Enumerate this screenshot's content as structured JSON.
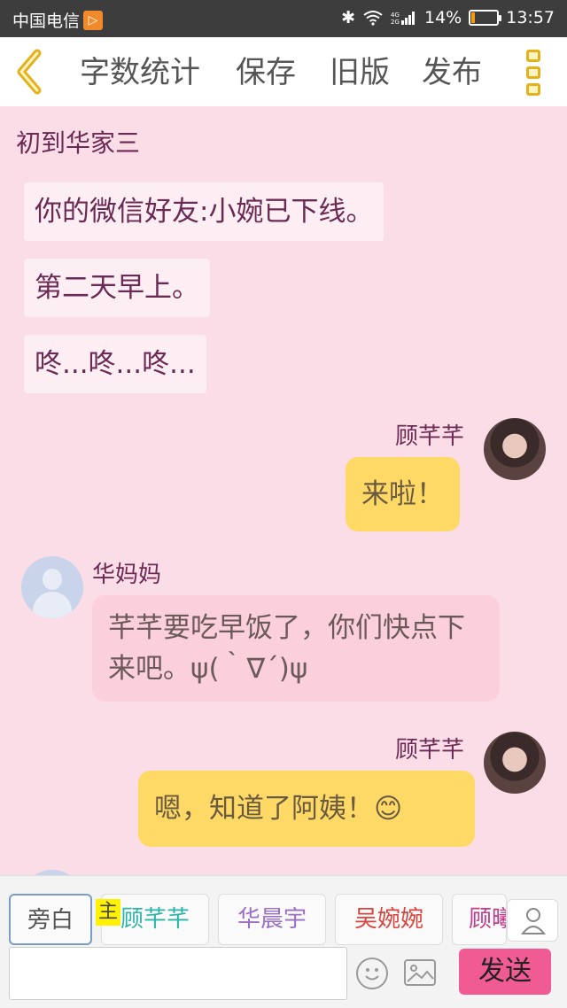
{
  "status_bar": {
    "carrier": "中国电信",
    "battery": "14%",
    "battery_level": 0.14,
    "time": "13:57"
  },
  "toolbar": {
    "word_count": "字数统计",
    "save": "保存",
    "old_version": "旧版",
    "publish": "发布"
  },
  "chapter": {
    "title": "初到华家三"
  },
  "narration": [
    "你的微信好友:小婉已下线。",
    "第二天早上。",
    "咚...咚...咚..."
  ],
  "messages": [
    {
      "speaker": "顾芊芊",
      "side": "right",
      "text": "来啦！"
    },
    {
      "speaker": "华妈妈",
      "side": "left",
      "text": "芊芊要吃早饭了，你们快点下来吧。ψ(｀∇´)ψ"
    },
    {
      "speaker": "顾芊芊",
      "side": "right",
      "text": "嗯，知道了阿姨！😊"
    }
  ],
  "roles": [
    {
      "label": "旁白",
      "color": "#555555"
    },
    {
      "label": "顾芊芊",
      "color": "#2bb5a8"
    },
    {
      "label": "华晨宇",
      "color": "#9b6fc4"
    },
    {
      "label": "吴婉婉",
      "color": "#d8453f"
    },
    {
      "label": "顾曦",
      "color": "#c33a8b"
    }
  ],
  "role_tag": "主",
  "input": {
    "value": "",
    "placeholder": ""
  },
  "send_label": "发送",
  "icons": {
    "back": "chevron-left-icon",
    "more": "more-icon",
    "contacts": "person-icon",
    "emoji": "emoji-icon",
    "image": "image-icon"
  }
}
